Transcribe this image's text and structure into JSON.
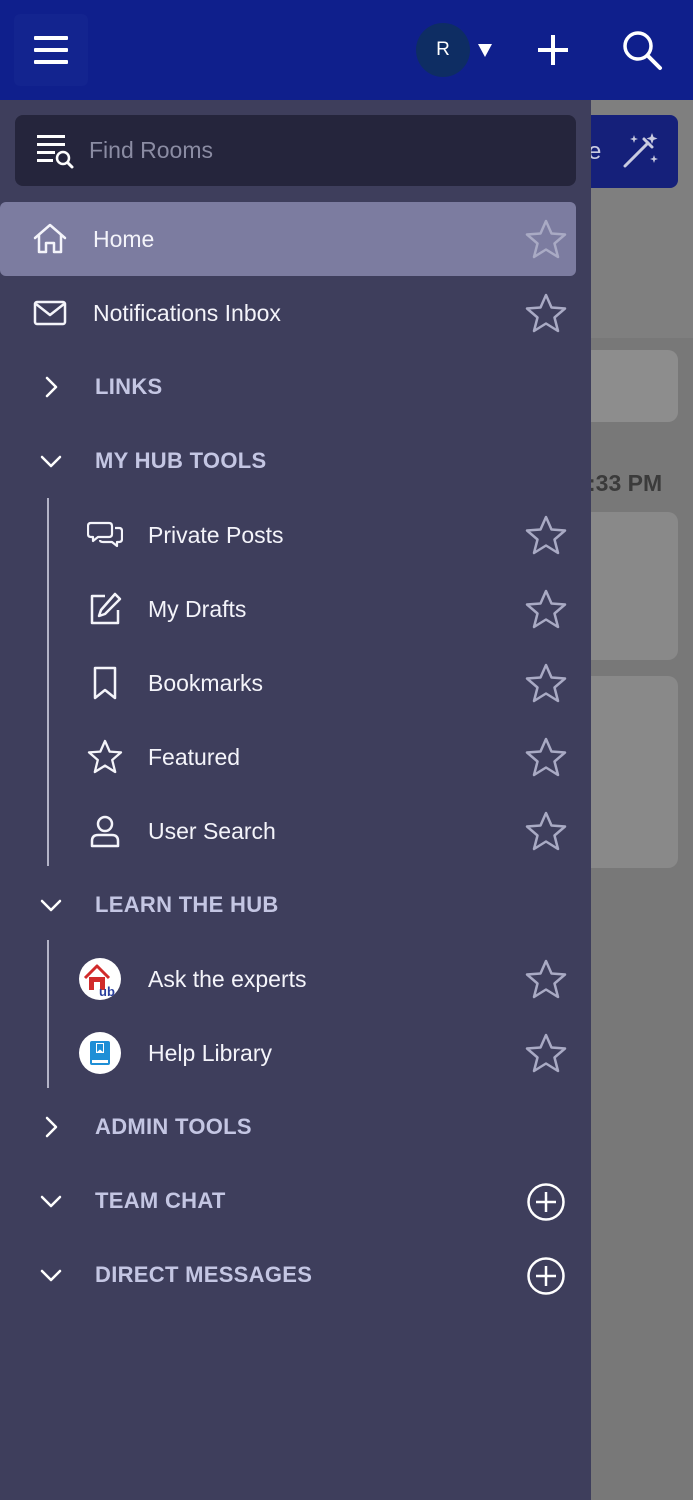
{
  "topbar": {
    "avatar_letter": "R",
    "menu_icon": "hamburger-icon",
    "caret_icon": "caret-down-icon",
    "add_icon": "plus-icon",
    "search_icon": "search-icon"
  },
  "background": {
    "magic_text": "e",
    "time_text": ":33 PM"
  },
  "drawer": {
    "search": {
      "placeholder": "Find Rooms"
    },
    "home_label": "Home",
    "notifications_label": "Notifications Inbox",
    "sections": {
      "links": "LINKS",
      "my_hub_tools": "MY HUB TOOLS",
      "learn_the_hub": "LEARN THE HUB",
      "admin_tools": "ADMIN TOOLS",
      "team_chat": "TEAM CHAT",
      "direct_messages": "DIRECT MESSAGES"
    },
    "my_hub_tools_items": [
      {
        "label": "Private Posts",
        "icon": "chat-bubbles-icon"
      },
      {
        "label": "My Drafts",
        "icon": "edit-icon"
      },
      {
        "label": "Bookmarks",
        "icon": "bookmark-icon"
      },
      {
        "label": "Featured",
        "icon": "star-icon"
      },
      {
        "label": "User Search",
        "icon": "user-icon"
      }
    ],
    "learn_items": [
      {
        "label": "Ask the experts",
        "icon": "hub-logo-icon"
      },
      {
        "label": "Help Library",
        "icon": "book-icon"
      }
    ]
  },
  "colors": {
    "topbar": "#0f1f8c",
    "drawer": "#3e3e5c",
    "active_row": "#7c7ca0",
    "section_text": "#c4c6e3"
  }
}
